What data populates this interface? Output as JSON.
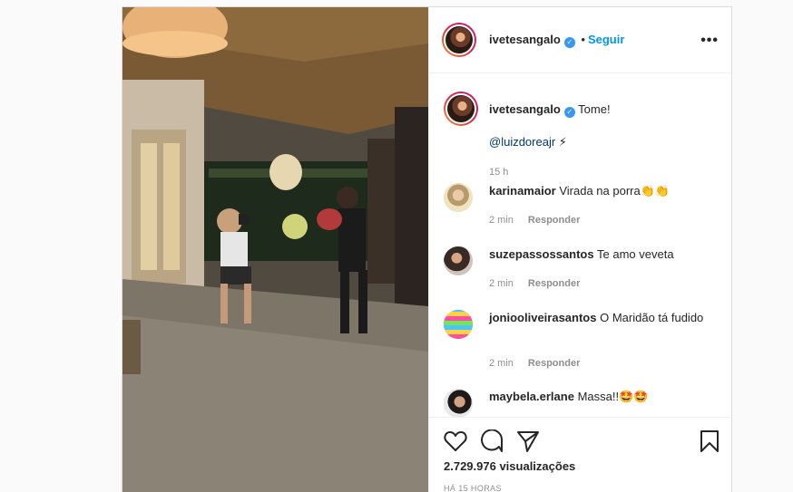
{
  "post": {
    "username": "ivetesangalo",
    "follow_label": "Seguir",
    "more_icon": "more-options-icon"
  },
  "caption": {
    "username": "ivetesangalo",
    "text": "Tome!",
    "mention": "@luizdoreajr",
    "emoji": "⚡",
    "time": "15 h"
  },
  "comments": [
    {
      "username": "karinamaior",
      "text": "Virada na porra👏👏",
      "time": "2 min",
      "reply": "Responder"
    },
    {
      "username": "suzepassossantos",
      "text": "Te amo veveta",
      "time": "2 min",
      "reply": "Responder"
    },
    {
      "username": "jonioolivei​rasantos",
      "text": "O Maridão tá fudido",
      "time": "2 min",
      "reply": "Responder"
    },
    {
      "username": "maybela.erlane",
      "text": "Massa!!🤩🤩",
      "time": "",
      "reply": ""
    }
  ],
  "stats": {
    "views": "2.729.976 visualizações",
    "posted": "HÁ 15 HORAS"
  }
}
